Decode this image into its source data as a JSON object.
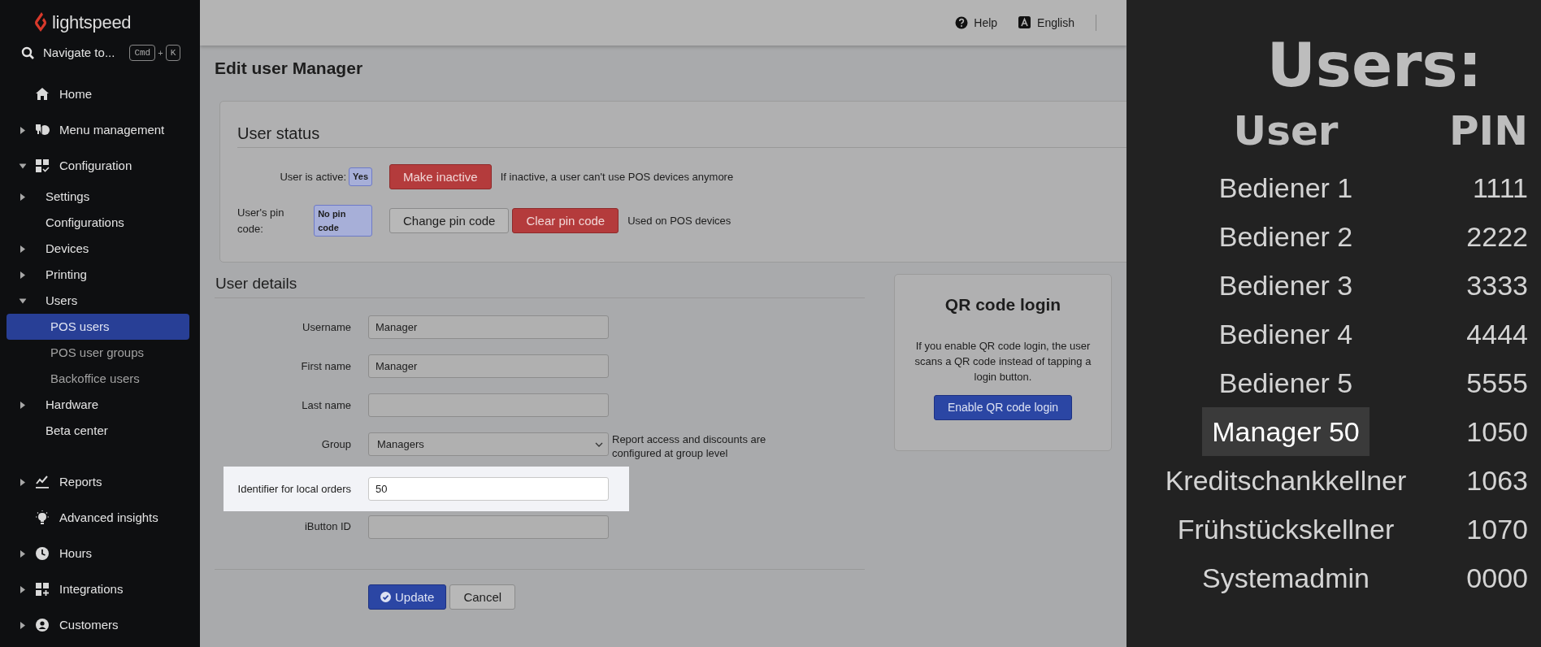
{
  "sidebar": {
    "logo": "lightspeed",
    "search": {
      "label": "Navigate to...",
      "keys": [
        "Cmd",
        "K"
      ],
      "joiner": "+"
    },
    "items": [
      {
        "label": "Home",
        "selected": false
      },
      {
        "label": "Menu management",
        "expanded": false,
        "selected": false
      },
      {
        "label": "Configuration",
        "expanded": true,
        "selected": false,
        "children": [
          {
            "label": "Settings",
            "expanded": false,
            "selected": false
          },
          {
            "label": "Configurations",
            "selected": false
          },
          {
            "label": "Devices",
            "expanded": false,
            "selected": false
          },
          {
            "label": "Printing",
            "expanded": false,
            "selected": false
          },
          {
            "label": "Users",
            "expanded": true,
            "selected": false,
            "children": [
              {
                "label": "POS users",
                "selected": true
              },
              {
                "label": "POS user groups",
                "selected": false
              },
              {
                "label": "Backoffice users",
                "selected": false
              }
            ]
          },
          {
            "label": "Hardware",
            "expanded": false,
            "selected": false
          },
          {
            "label": "Beta center",
            "selected": false
          }
        ]
      },
      {
        "label": "Reports",
        "expanded": false,
        "selected": false
      },
      {
        "label": "Advanced insights",
        "selected": false
      },
      {
        "label": "Hours",
        "expanded": false,
        "selected": false
      },
      {
        "label": "Integrations",
        "expanded": false,
        "selected": false
      },
      {
        "label": "Customers",
        "expanded": false,
        "selected": false
      }
    ]
  },
  "header": {
    "links": [
      "Help",
      "English"
    ]
  },
  "page_title": "Edit user Manager",
  "user_status": {
    "title": "User status",
    "rows": [
      {
        "label": "User is active:",
        "badge": "Yes",
        "buttons": [
          {
            "label": "Make inactive",
            "kind": "danger"
          }
        ],
        "help": "If inactive, a user can't use POS devices anymore"
      },
      {
        "label": "User's pin code:",
        "badge": "No pin code",
        "buttons": [
          {
            "label": "Change pin code",
            "kind": "default"
          },
          {
            "label": "Clear pin code",
            "kind": "danger"
          }
        ],
        "help": "Used on POS devices"
      }
    ]
  },
  "user_details": {
    "title": "User details",
    "fields": [
      {
        "label": "Username",
        "kind": "text",
        "value": "Manager",
        "highlighted": false
      },
      {
        "label": "First name",
        "kind": "text",
        "value": "Manager",
        "highlighted": false
      },
      {
        "label": "Last name",
        "kind": "text",
        "highlighted": false
      },
      {
        "label": "Group",
        "kind": "select",
        "value": "Managers",
        "help": "Report access and discounts are configured at group level",
        "highlighted": false
      },
      {
        "label": "Identifier for local orders",
        "kind": "text",
        "value": "50",
        "highlighted": true
      },
      {
        "label": "iButton ID",
        "kind": "text",
        "highlighted": false
      }
    ],
    "actions": [
      {
        "label": "Update",
        "kind": "primary"
      },
      {
        "label": "Cancel",
        "kind": "default"
      }
    ]
  },
  "qr_login": {
    "title": "QR code login",
    "text": "If you enable QR code login, the user scans a QR code instead of tapping a login button.",
    "button": "Enable QR code login"
  },
  "users_table": {
    "title": "Users:",
    "columns": [
      "User",
      "PIN"
    ],
    "rows": [
      {
        "user": "Bediener 1",
        "pin": "1111",
        "highlighted": false
      },
      {
        "user": "Bediener 2",
        "pin": "2222",
        "highlighted": false
      },
      {
        "user": "Bediener 3",
        "pin": "3333",
        "highlighted": false
      },
      {
        "user": "Bediener 4",
        "pin": "4444",
        "highlighted": false
      },
      {
        "user": "Bediener 5",
        "pin": "5555",
        "highlighted": false
      },
      {
        "user": "Manager 50",
        "pin": "1050",
        "highlighted": true
      },
      {
        "user": "Kreditschankkellner",
        "pin": "1063",
        "highlighted": false
      },
      {
        "user": "Frühstückskellner",
        "pin": "1070",
        "highlighted": false
      },
      {
        "user": "Systemadmin",
        "pin": "0000",
        "highlighted": false
      }
    ]
  }
}
